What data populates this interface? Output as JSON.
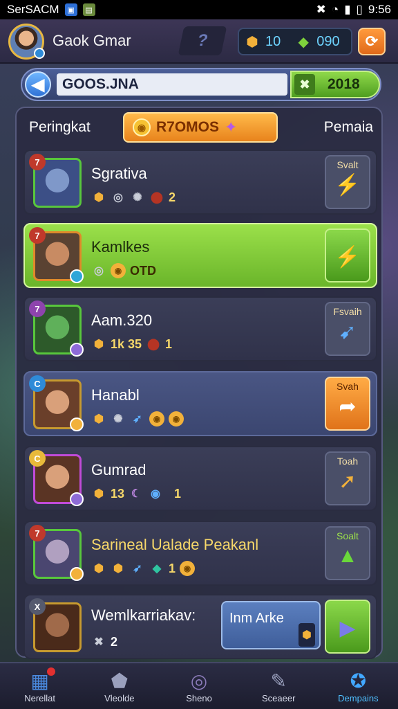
{
  "status_bar": {
    "carrier": "SerSACM",
    "time": "9:56",
    "icons": [
      "mute-icon",
      "wifi-icon",
      "signal-icon",
      "battery-icon"
    ]
  },
  "header": {
    "player_name": "Gaok Gmar",
    "help_label": "?",
    "gold_value": "10",
    "gem_value": "090"
  },
  "search": {
    "value": "GOOS.JNA",
    "score": "2018"
  },
  "panel": {
    "tab_left": "Peringkat",
    "tab_right": "Pemaia",
    "promo_label": "R7OMOS"
  },
  "rows": [
    {
      "rank": "7",
      "name": "Sgrativa",
      "stat_a": "2",
      "stat_b": "",
      "action_label": "Svalt",
      "rank_color": "#c0392b",
      "frame_color": "#58c73c"
    },
    {
      "rank": "7",
      "name": "Kamlkes",
      "stat_a": "OTD",
      "stat_b": "",
      "action_label": "",
      "rank_color": "#c0392b",
      "frame_color": "#e08a2a"
    },
    {
      "rank": "7",
      "name": "Aam.320",
      "stat_a": "1k 35",
      "stat_b": "1",
      "action_label": "Fsvaih",
      "rank_color": "#8e44ad",
      "frame_color": "#58c73c"
    },
    {
      "rank": "C",
      "name": "Hanabl",
      "stat_a": "",
      "stat_b": "",
      "action_label": "Svah",
      "rank_color": "#2f8bd8",
      "frame_color": "#c79a2f"
    },
    {
      "rank": "C",
      "name": "Gumrad",
      "stat_a": "13",
      "stat_b": "1",
      "action_label": "Toah",
      "rank_color": "#e8b93a",
      "frame_color": "#c04bd8"
    },
    {
      "rank": "7",
      "name": "Sarineal Ualade Peakanl",
      "stat_a": "1",
      "stat_b": "",
      "action_label": "Soalt",
      "rank_color": "#c0392b",
      "frame_color": "#58c73c"
    },
    {
      "rank": "X",
      "name": "Wemlkarriakav:",
      "stat_a": "2",
      "stat_b": "",
      "input_label": "Inm Arke",
      "rank_color": "#555a6e",
      "frame_color": "#c79a2f"
    }
  ],
  "bottom_nav": [
    {
      "label": "Nerellat",
      "icon": "calendar-icon"
    },
    {
      "label": "Vleolde",
      "icon": "shield-swords-icon"
    },
    {
      "label": "Sheno",
      "icon": "portal-icon"
    },
    {
      "label": "Sceaeer",
      "icon": "edit-icon"
    },
    {
      "label": "Dempains",
      "icon": "badge-icon"
    }
  ],
  "colors": {
    "accent_orange": "#e8831c",
    "accent_green": "#6ab52a",
    "panel_bg": "#2a2c42",
    "highlight_blue": "#42a8ff"
  }
}
